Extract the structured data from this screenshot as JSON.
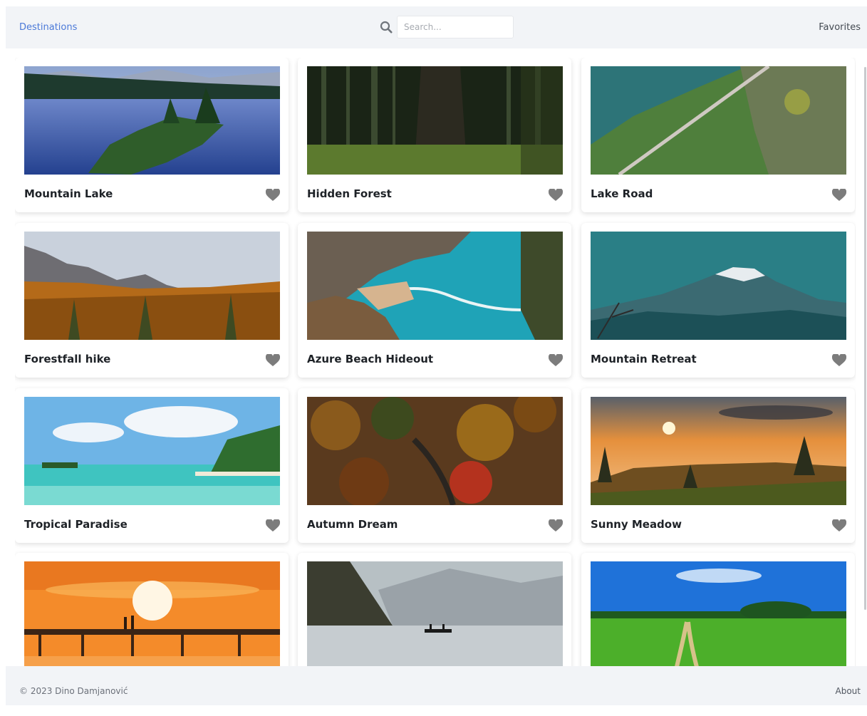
{
  "header": {
    "brand": "Destinations",
    "search_placeholder": "Search...",
    "favorites_label": "Favorites"
  },
  "icons": {
    "search": "search-icon",
    "favorite": "heart-icon"
  },
  "colors": {
    "brand_link": "#4b79d8",
    "header_bg": "#f2f4f7",
    "heart": "#7c7c7c"
  },
  "cards": [
    {
      "title": "Mountain Lake"
    },
    {
      "title": "Hidden Forest"
    },
    {
      "title": "Lake Road"
    },
    {
      "title": "Forestfall hike"
    },
    {
      "title": "Azure Beach Hideout"
    },
    {
      "title": "Mountain Retreat"
    },
    {
      "title": "Tropical Paradise"
    },
    {
      "title": "Autumn Dream"
    },
    {
      "title": "Sunny Meadow"
    },
    {
      "title": ""
    },
    {
      "title": ""
    },
    {
      "title": ""
    }
  ],
  "footer": {
    "copyright": "© 2023 Dino Damjanović",
    "about_label": "About"
  }
}
